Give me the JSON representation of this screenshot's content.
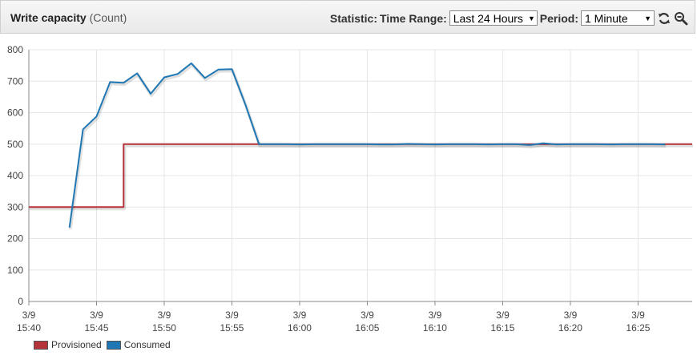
{
  "header": {
    "title": "Write capacity",
    "unit": "(Count)",
    "statistic_label": "Statistic:",
    "time_range_label": "Time Range:",
    "time_range_value": "Last 24 Hours",
    "period_label": "Period:",
    "period_value": "1 Minute"
  },
  "icons": {
    "refresh": "refresh-icon",
    "zoom": "zoom-out-icon"
  },
  "colors": {
    "provisioned": "#b5333b",
    "consumed": "#1f77b4",
    "grid": "#e6e6e6"
  },
  "chart_data": {
    "type": "line",
    "title": "Write capacity",
    "ylabel": "",
    "xlabel": "",
    "ylim": [
      0,
      800
    ],
    "yticks": [
      0,
      100,
      200,
      300,
      400,
      500,
      600,
      700,
      800
    ],
    "xlim": [
      "15:40",
      "16:29"
    ],
    "xticks": [
      {
        "date": "3/9",
        "time": "15:40"
      },
      {
        "date": "3/9",
        "time": "15:45"
      },
      {
        "date": "3/9",
        "time": "15:50"
      },
      {
        "date": "3/9",
        "time": "15:55"
      },
      {
        "date": "3/9",
        "time": "16:00"
      },
      {
        "date": "3/9",
        "time": "16:05"
      },
      {
        "date": "3/9",
        "time": "16:10"
      },
      {
        "date": "3/9",
        "time": "16:15"
      },
      {
        "date": "3/9",
        "time": "16:20"
      },
      {
        "date": "3/9",
        "time": "16:25"
      }
    ],
    "grid": true,
    "legend_position": "bottom-left",
    "series": [
      {
        "name": "Provisioned",
        "step": true,
        "points": [
          [
            "15:40",
            300
          ],
          [
            "15:47",
            300
          ],
          [
            "15:47",
            500
          ],
          [
            "16:29",
            500
          ]
        ]
      },
      {
        "name": "Consumed",
        "step": false,
        "points": [
          [
            "15:43",
            235
          ],
          [
            "15:44",
            547
          ],
          [
            "15:45",
            588
          ],
          [
            "15:46",
            697
          ],
          [
            "15:47",
            695
          ],
          [
            "15:48",
            725
          ],
          [
            "15:49",
            660
          ],
          [
            "15:50",
            712
          ],
          [
            "15:51",
            723
          ],
          [
            "15:52",
            757
          ],
          [
            "15:53",
            710
          ],
          [
            "15:54",
            737
          ],
          [
            "15:55",
            738
          ],
          [
            "15:56",
            625
          ],
          [
            "15:57",
            500
          ],
          [
            "15:58",
            500
          ],
          [
            "15:59",
            500
          ],
          [
            "16:00",
            499
          ],
          [
            "16:01",
            500
          ],
          [
            "16:02",
            500
          ],
          [
            "16:03",
            500
          ],
          [
            "16:04",
            500
          ],
          [
            "16:05",
            500
          ],
          [
            "16:06",
            499
          ],
          [
            "16:07",
            499
          ],
          [
            "16:08",
            501
          ],
          [
            "16:09",
            500
          ],
          [
            "16:10",
            499
          ],
          [
            "16:11",
            500
          ],
          [
            "16:12",
            500
          ],
          [
            "16:13",
            500
          ],
          [
            "16:14",
            499
          ],
          [
            "16:15",
            500
          ],
          [
            "16:16",
            500
          ],
          [
            "16:17",
            497
          ],
          [
            "16:18",
            503
          ],
          [
            "16:19",
            499
          ],
          [
            "16:20",
            500
          ],
          [
            "16:21",
            500
          ],
          [
            "16:22",
            500
          ],
          [
            "16:23",
            499
          ],
          [
            "16:24",
            500
          ],
          [
            "16:25",
            500
          ],
          [
            "16:26",
            500
          ],
          [
            "16:27",
            499
          ]
        ]
      }
    ]
  }
}
